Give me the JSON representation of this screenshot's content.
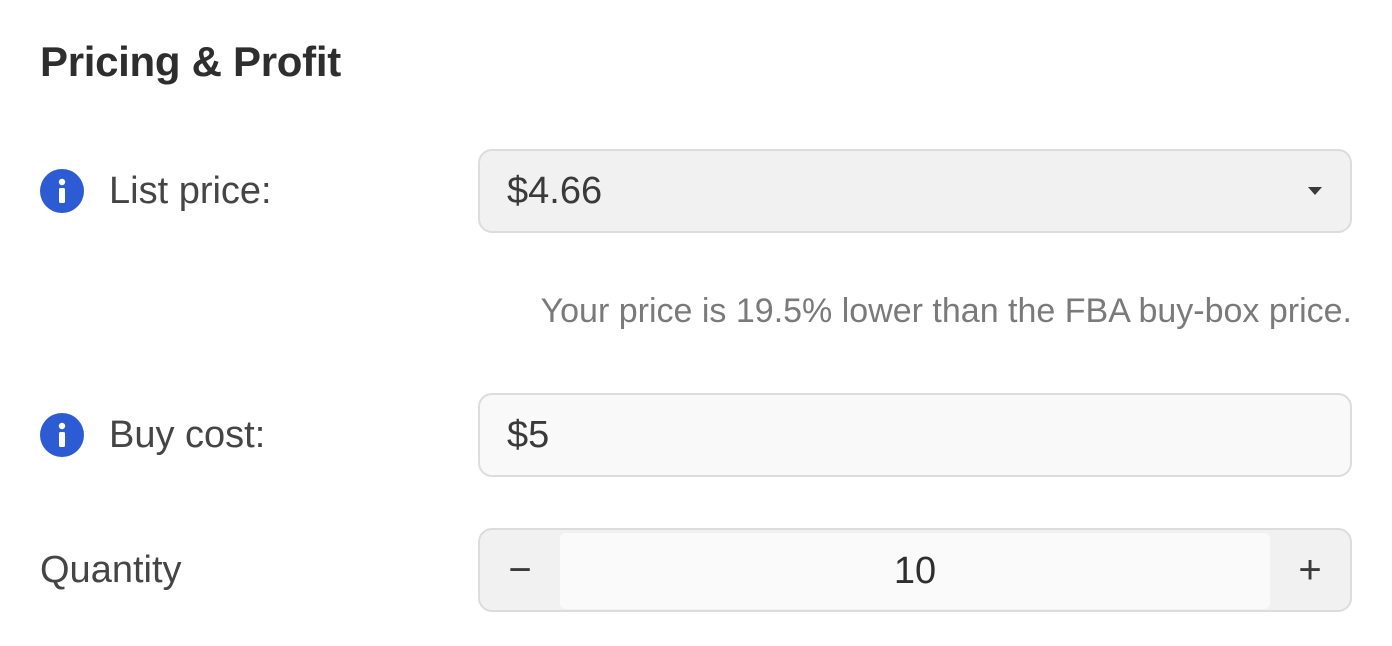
{
  "section": {
    "title": "Pricing & Profit"
  },
  "list_price": {
    "label": "List price:",
    "value": "$4.66",
    "icon": "info-icon",
    "hint": "Your price is 19.5% lower than the FBA buy-box price."
  },
  "buy_cost": {
    "label": "Buy cost:",
    "value": "$5",
    "icon": "info-icon"
  },
  "quantity": {
    "label": "Quantity",
    "value": "10",
    "decrement_symbol": "−",
    "increment_symbol": "+"
  },
  "colors": {
    "info_icon": "#2d5bd3",
    "field_border": "#dcdcdc",
    "hint_text": "#7a7a7a"
  }
}
